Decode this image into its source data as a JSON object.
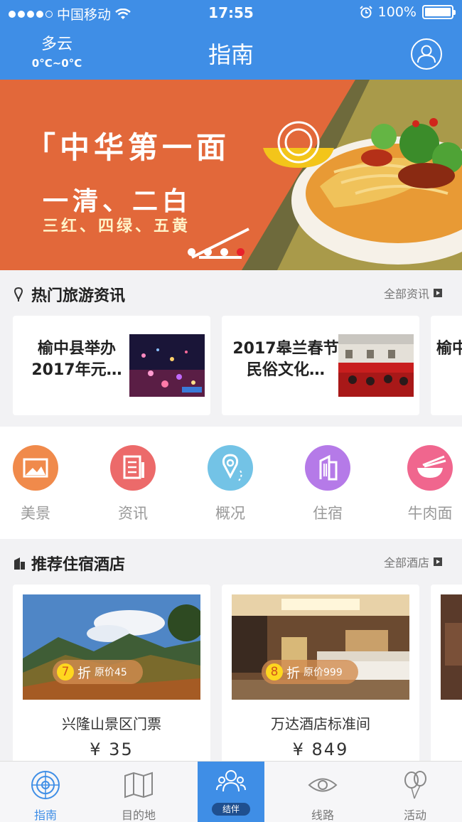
{
  "status": {
    "carrier": "中国移动",
    "time": "17:55",
    "battery": "100%"
  },
  "header": {
    "weather": "多云",
    "temp": "0°C~0°C",
    "title": "指南"
  },
  "banner": {
    "line1": "「中华第一面",
    "line2": "一清、二白",
    "line3": "三红、四绿、五黄"
  },
  "news": {
    "title": "热门旅游资讯",
    "more": "全部资讯",
    "items": [
      {
        "text": "榆中县举办2017年元…"
      },
      {
        "text": "2017皋兰春节民俗文化…"
      },
      {
        "text": "榆中动国"
      }
    ]
  },
  "categories": [
    {
      "label": "美景",
      "color": "#f08a4b"
    },
    {
      "label": "资讯",
      "color": "#ec6a6a"
    },
    {
      "label": "概况",
      "color": "#73c3e6"
    },
    {
      "label": "住宿",
      "color": "#b57ae8"
    },
    {
      "label": "牛肉面",
      "color": "#f0668e"
    }
  ],
  "hotels": {
    "title": "推荐住宿酒店",
    "more": "全部酒店",
    "items": [
      {
        "discount": "7",
        "zhe": "折",
        "original": "原价45",
        "name": "兴隆山景区门票",
        "price": "¥ 35"
      },
      {
        "discount": "8",
        "zhe": "折",
        "original": "原价999",
        "name": "万达酒店标准间",
        "price": "¥ 849"
      }
    ]
  },
  "tabs": [
    {
      "label": "指南",
      "icon": "radar-icon"
    },
    {
      "label": "目的地",
      "icon": "map-icon"
    },
    {
      "label": "结伴",
      "icon": "group-icon"
    },
    {
      "label": "线路",
      "icon": "eye-icon"
    },
    {
      "label": "活动",
      "icon": "balloon-icon"
    }
  ],
  "colors": {
    "primary": "#3f8ee6",
    "banner": "#e2683a",
    "active_dot": "#e8212b"
  }
}
